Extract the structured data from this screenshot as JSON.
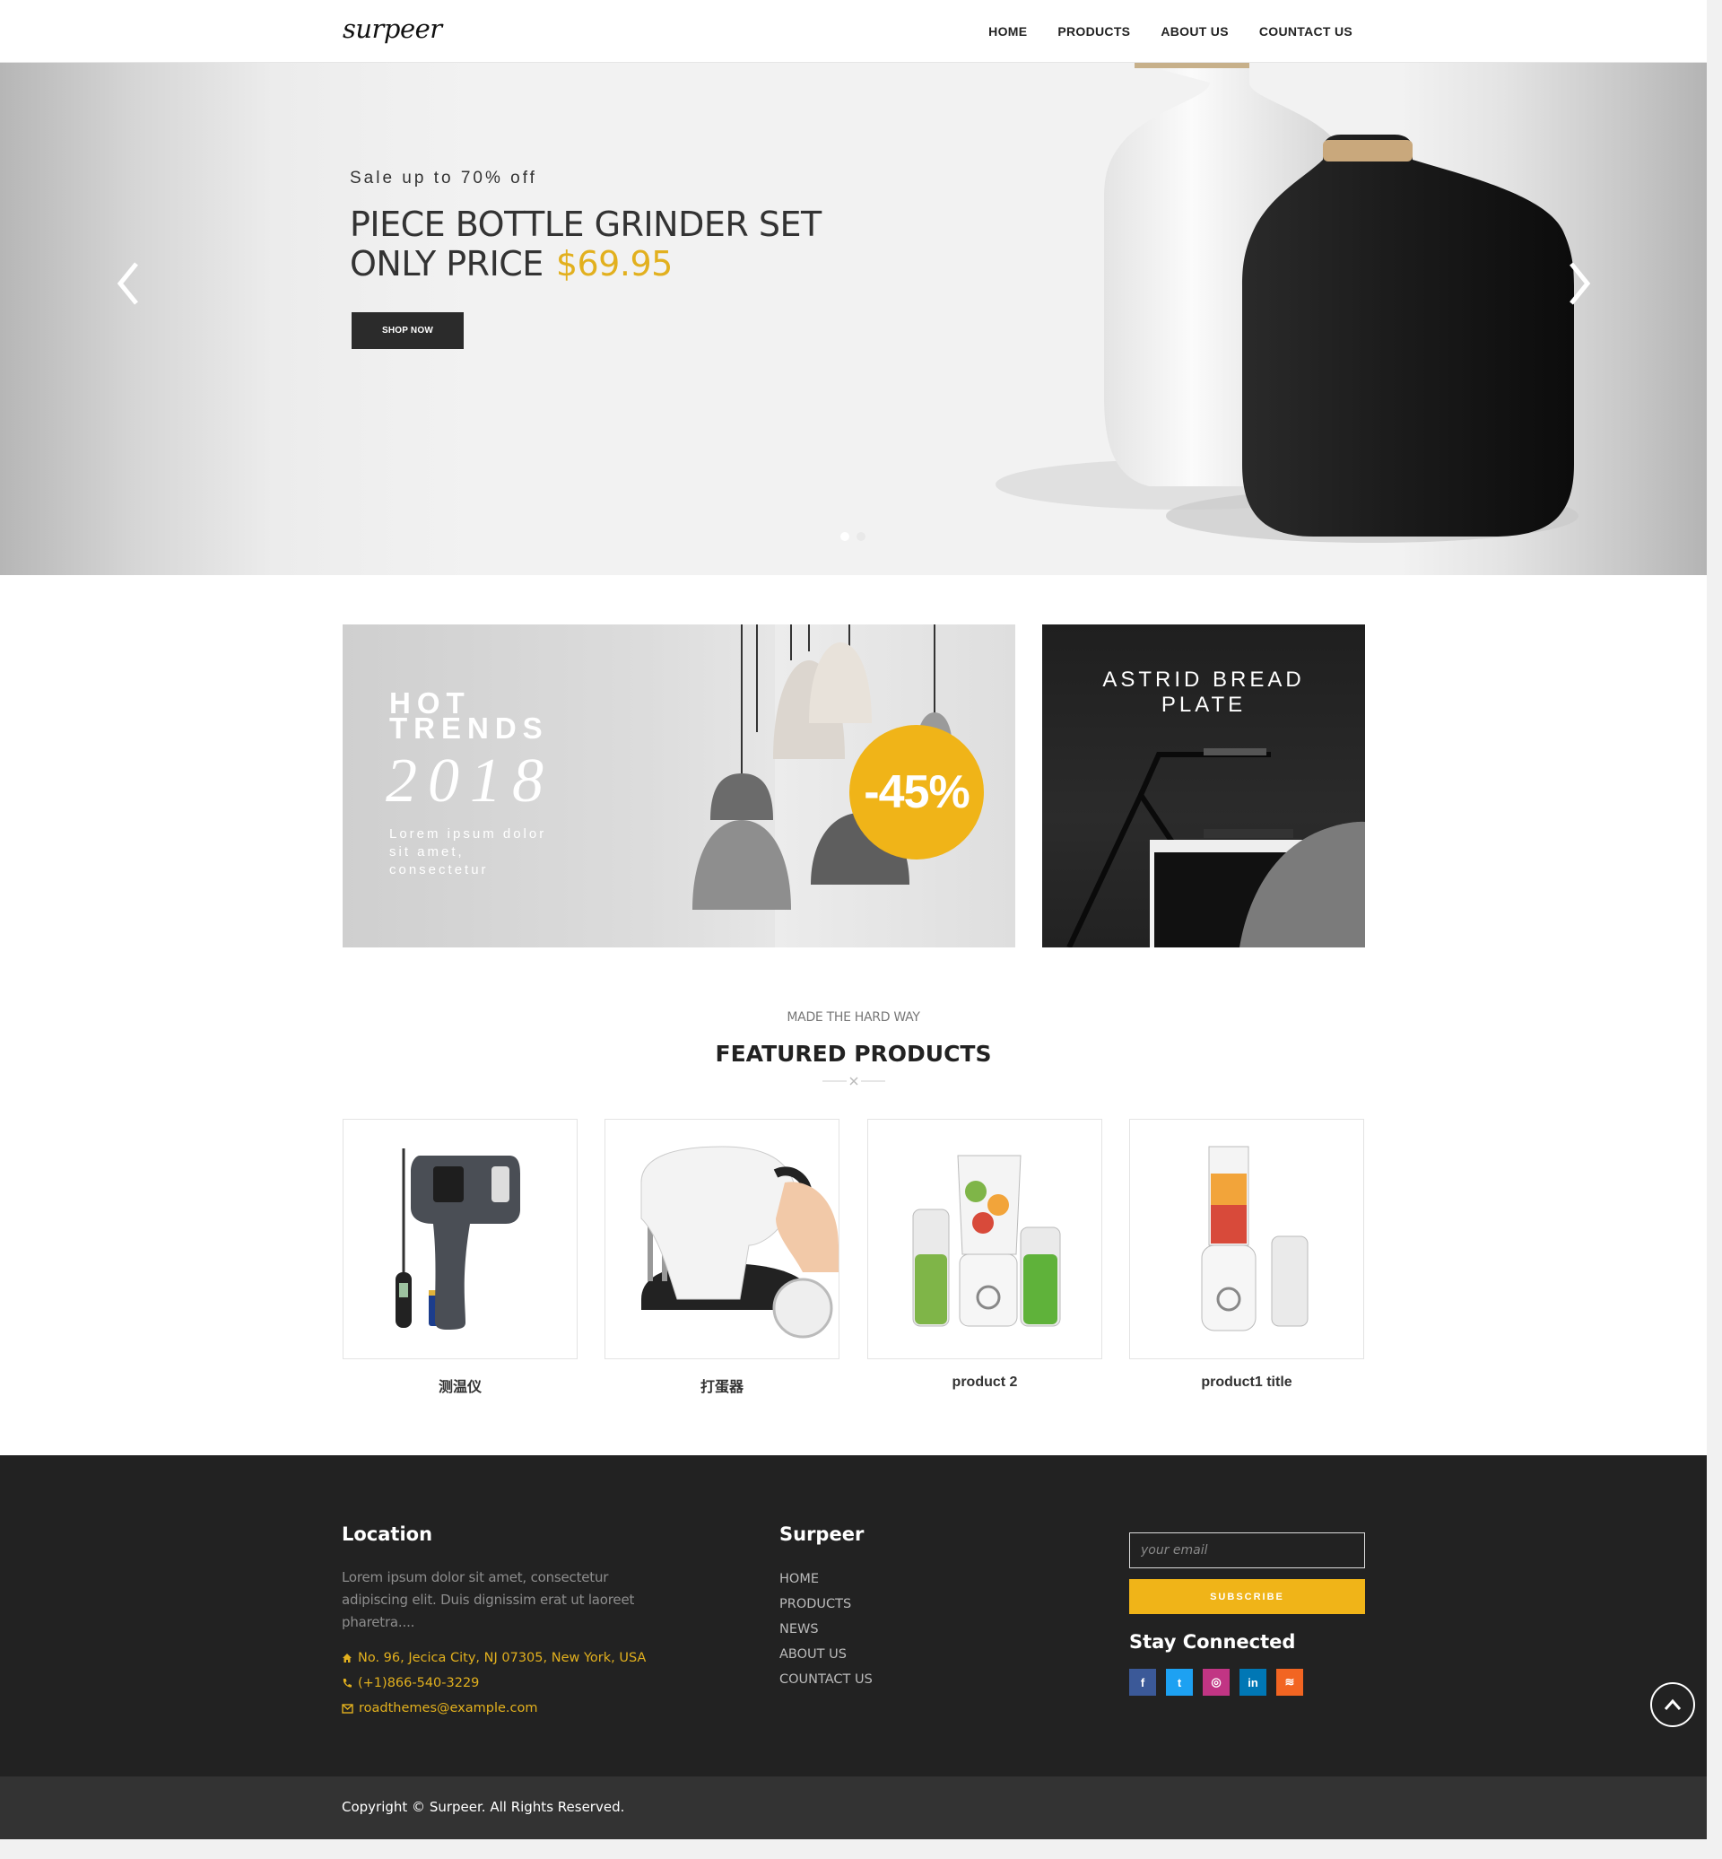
{
  "header": {
    "logo_text": "surpeer",
    "nav": [
      "HOME",
      "PRODUCTS",
      "ABOUT US",
      "COUNTACT US"
    ]
  },
  "hero": {
    "kicker": "Sale up to 70% off",
    "title_line1": "PIECE BOTTLE GRINDER SET",
    "title_line2": "ONLY PRICE",
    "price": "$69.95",
    "button_label": "SHOP NOW",
    "active_slide": 1,
    "slide_count": 2
  },
  "promos": {
    "left": {
      "line1": "HOT",
      "line2": "TRENDS",
      "year": "2018",
      "subtitle": "Lorem ipsum dolor sit amet, consectetur",
      "badge": "-45%"
    },
    "right": {
      "title_line1": "ASTRID BREAD",
      "title_line2": "PLATE"
    }
  },
  "featured": {
    "kicker": "MADE THE HARD WAY",
    "title": "FEATURED PRODUCTS",
    "products": [
      {
        "name": "测温仪"
      },
      {
        "name": "打蛋器"
      },
      {
        "name": "product 2"
      },
      {
        "name": "product1 title"
      }
    ]
  },
  "footer": {
    "location": {
      "heading": "Location",
      "text": "Lorem ipsum dolor sit amet, consectetur adipiscing elit. Duis dignissim erat ut laoreet pharetra....",
      "address": "No. 96, Jecica City, NJ 07305, New York, USA",
      "phone": "(+1)866-540-3229",
      "email": "roadthemes@example.com"
    },
    "links": {
      "heading": "Surpeer",
      "items": [
        "HOME",
        "PRODUCTS",
        "NEWS",
        "ABOUT US",
        "COUNTACT US"
      ]
    },
    "newsletter": {
      "placeholder": "your email",
      "button": "SUBSCRIBE"
    },
    "social": {
      "heading": "Stay Connected",
      "items": [
        {
          "icon": "facebook-icon",
          "glyph": "f",
          "color": "#3b5998"
        },
        {
          "icon": "twitter-icon",
          "glyph": "t",
          "color": "#1da1f2"
        },
        {
          "icon": "instagram-icon",
          "glyph": "◎",
          "color": "#c13584"
        },
        {
          "icon": "linkedin-icon",
          "glyph": "in",
          "color": "#0077b5"
        },
        {
          "icon": "rss-icon",
          "glyph": "≋",
          "color": "#f26522"
        }
      ]
    },
    "copyright": "Copyright © Surpeer. All Rights Reserved."
  },
  "colors": {
    "accent": "#f0b418",
    "price": "#e2b01e",
    "footer_bg": "#222222",
    "copyright_bg": "#333333"
  }
}
